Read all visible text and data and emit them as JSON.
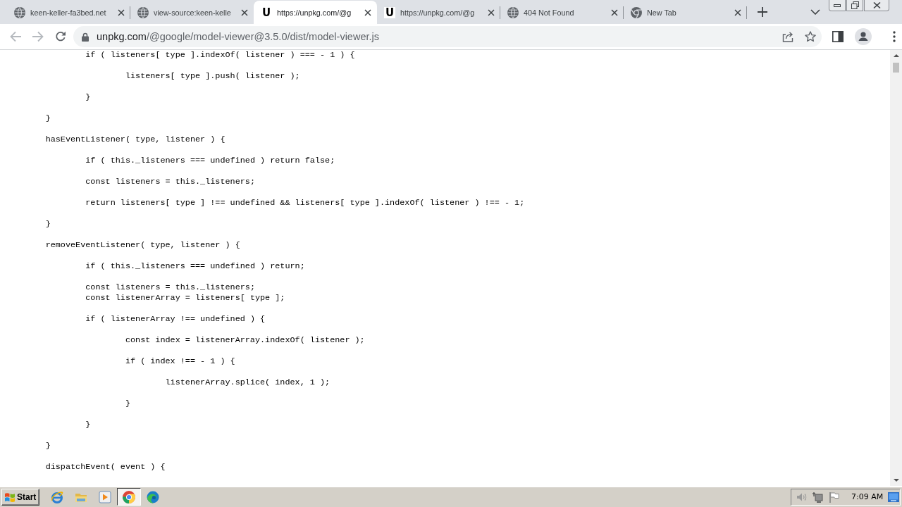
{
  "tabs": [
    {
      "title": "keen-keller-fa3bed.net",
      "favicon": {
        "kind": "globe"
      },
      "selected": false
    },
    {
      "title": "view-source:keen-kelle",
      "favicon": {
        "kind": "globe"
      },
      "selected": false
    },
    {
      "title": "https://unpkg.com/@g",
      "favicon": {
        "kind": "letter",
        "text": "U"
      },
      "selected": true
    },
    {
      "title": "https://unpkg.com/@g",
      "favicon": {
        "kind": "letter",
        "text": "U"
      },
      "selected": false
    },
    {
      "title": "404 Not Found",
      "favicon": {
        "kind": "globe"
      },
      "selected": false
    },
    {
      "title": "New Tab",
      "favicon": {
        "kind": "chrome"
      },
      "selected": false
    }
  ],
  "toolbar": {
    "back": {
      "disabled": true
    },
    "forward": {
      "disabled": true
    },
    "address": {
      "host": "unpkg.com",
      "path": "/@google/model-viewer@3.5.0/dist/model-viewer.js"
    }
  },
  "page": {
    "code_blocks": [
      [
        "\t\tif ( listeners[ type ].indexOf( listener ) === - 1 ) {"
      ],
      [
        "\t\t\tlisteners[ type ].push( listener );"
      ],
      [
        "\t\t}"
      ],
      [
        "\t}"
      ],
      [
        "\thasEventListener( type, listener ) {"
      ],
      [
        "\t\tif ( this._listeners === undefined ) return false;"
      ],
      [
        "\t\tconst listeners = this._listeners;"
      ],
      [
        "\t\treturn listeners[ type ] !== undefined && listeners[ type ].indexOf( listener ) !== - 1;"
      ],
      [
        "\t}"
      ],
      [
        "\tremoveEventListener( type, listener ) {"
      ],
      [
        "\t\tif ( this._listeners === undefined ) return;"
      ],
      [
        "\t\tconst listeners = this._listeners;",
        "\t\tconst listenerArray = listeners[ type ];"
      ],
      [
        "\t\tif ( listenerArray !== undefined ) {"
      ],
      [
        "\t\t\tconst index = listenerArray.indexOf( listener );"
      ],
      [
        "\t\t\tif ( index !== - 1 ) {"
      ],
      [
        "\t\t\t\tlistenerArray.splice( index, 1 );"
      ],
      [
        "\t\t\t}"
      ],
      [
        "\t\t}"
      ],
      [
        "\t}"
      ],
      [
        "\tdispatchEvent( event ) {"
      ]
    ]
  },
  "taskbar": {
    "start": "Start",
    "apps": [
      {
        "kind": "ie",
        "active": false
      },
      {
        "kind": "folder",
        "active": false
      },
      {
        "kind": "media",
        "active": false
      },
      {
        "kind": "chrome",
        "active": true
      },
      {
        "kind": "edge",
        "active": false
      }
    ],
    "clock": "7:09 AM"
  }
}
